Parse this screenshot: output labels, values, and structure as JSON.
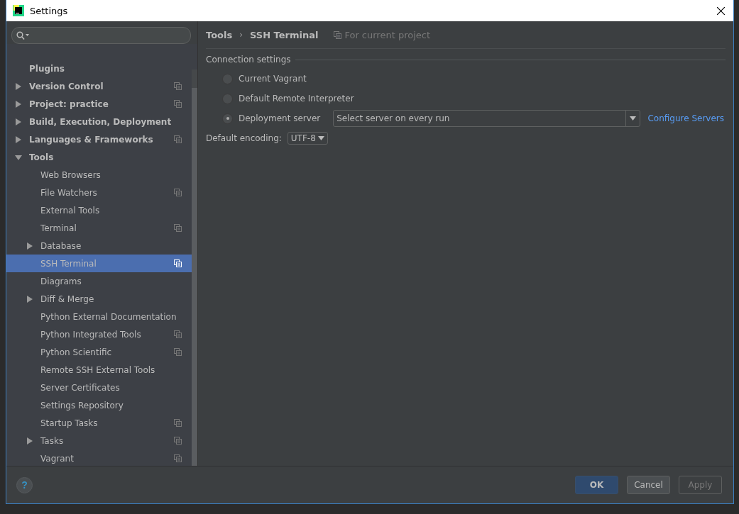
{
  "window": {
    "title": "Settings"
  },
  "sidebar": {
    "items": [
      {
        "label": "Plugins",
        "bold": true,
        "project_scope": false,
        "selected": false
      },
      {
        "label": "Version Control",
        "bold": true,
        "expanded": false,
        "project_scope": true,
        "selected": false
      },
      {
        "label": "Project: practice",
        "bold": true,
        "expanded": false,
        "project_scope": true,
        "selected": false
      },
      {
        "label": "Build, Execution, Deployment",
        "bold": true,
        "expanded": false,
        "project_scope": false,
        "selected": false
      },
      {
        "label": "Languages & Frameworks",
        "bold": true,
        "expanded": false,
        "project_scope": true,
        "selected": false
      },
      {
        "label": "Tools",
        "bold": true,
        "expanded": true,
        "project_scope": false,
        "selected": false,
        "children": [
          {
            "label": "Web Browsers",
            "project_scope": false,
            "selected": false
          },
          {
            "label": "File Watchers",
            "project_scope": true,
            "selected": false
          },
          {
            "label": "External Tools",
            "project_scope": false,
            "selected": false
          },
          {
            "label": "Terminal",
            "project_scope": true,
            "selected": false
          },
          {
            "label": "Database",
            "expanded": false,
            "project_scope": false,
            "selected": false
          },
          {
            "label": "SSH Terminal",
            "project_scope": true,
            "selected": true
          },
          {
            "label": "Diagrams",
            "project_scope": false,
            "selected": false
          },
          {
            "label": "Diff & Merge",
            "expanded": false,
            "project_scope": false,
            "selected": false
          },
          {
            "label": "Python External Documentation",
            "project_scope": false,
            "selected": false
          },
          {
            "label": "Python Integrated Tools",
            "project_scope": true,
            "selected": false
          },
          {
            "label": "Python Scientific",
            "project_scope": true,
            "selected": false
          },
          {
            "label": "Remote SSH External Tools",
            "project_scope": false,
            "selected": false
          },
          {
            "label": "Server Certificates",
            "project_scope": false,
            "selected": false
          },
          {
            "label": "Settings Repository",
            "project_scope": false,
            "selected": false
          },
          {
            "label": "Startup Tasks",
            "project_scope": true,
            "selected": false
          },
          {
            "label": "Tasks",
            "expanded": false,
            "project_scope": true,
            "selected": false
          },
          {
            "label": "Vagrant",
            "project_scope": true,
            "selected": false
          }
        ]
      }
    ]
  },
  "breadcrumb": {
    "parts": [
      "Tools",
      "SSH Terminal"
    ],
    "separator": "›",
    "scope_note": "For current project"
  },
  "connection": {
    "title": "Connection settings",
    "options": [
      {
        "label": "Current Vagrant",
        "selected": false
      },
      {
        "label": "Default Remote Interpreter",
        "selected": false
      },
      {
        "label": "Deployment server",
        "selected": true
      }
    ],
    "server_select": {
      "value": "Select server on every run"
    },
    "link": "Configure Servers"
  },
  "encoding": {
    "label": "Default encoding:",
    "value": "UTF-8"
  },
  "footer": {
    "help": "?",
    "buttons": [
      {
        "label": "OK",
        "kind": "default",
        "disabled": false
      },
      {
        "label": "Cancel",
        "kind": "normal",
        "disabled": false
      },
      {
        "label": "Apply",
        "kind": "normal",
        "disabled": true
      }
    ]
  }
}
